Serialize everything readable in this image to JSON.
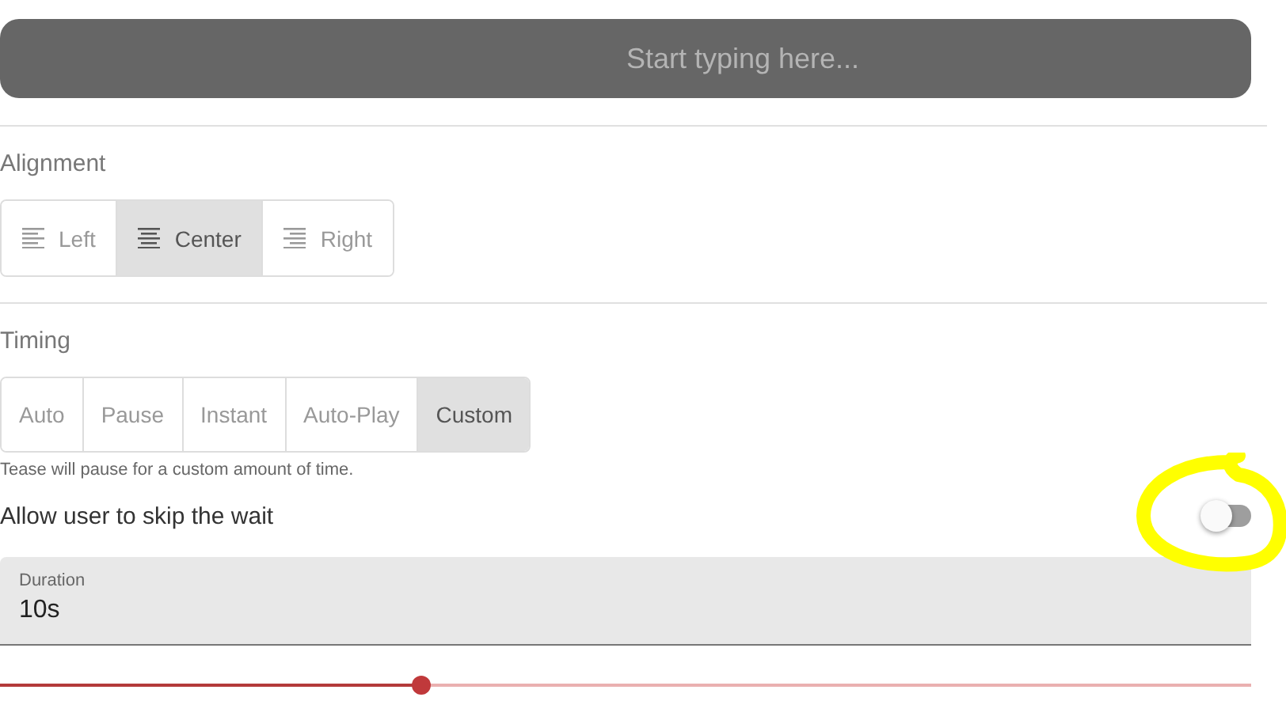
{
  "search": {
    "placeholder": "Start typing here..."
  },
  "alignment": {
    "label": "Alignment",
    "options": [
      {
        "label": "Left",
        "kind": "left",
        "selected": false
      },
      {
        "label": "Center",
        "kind": "center",
        "selected": true
      },
      {
        "label": "Right",
        "kind": "right",
        "selected": false
      }
    ]
  },
  "timing": {
    "label": "Timing",
    "options": [
      {
        "label": "Auto",
        "selected": false
      },
      {
        "label": "Pause",
        "selected": false
      },
      {
        "label": "Instant",
        "selected": false
      },
      {
        "label": "Auto-Play",
        "selected": false
      },
      {
        "label": "Custom",
        "selected": true
      }
    ],
    "helper": "Tease will pause for a custom amount of time."
  },
  "skip_toggle": {
    "label": "Allow user to skip the wait",
    "on": false
  },
  "duration": {
    "label": "Duration",
    "value": "10s",
    "level": 0.337
  }
}
